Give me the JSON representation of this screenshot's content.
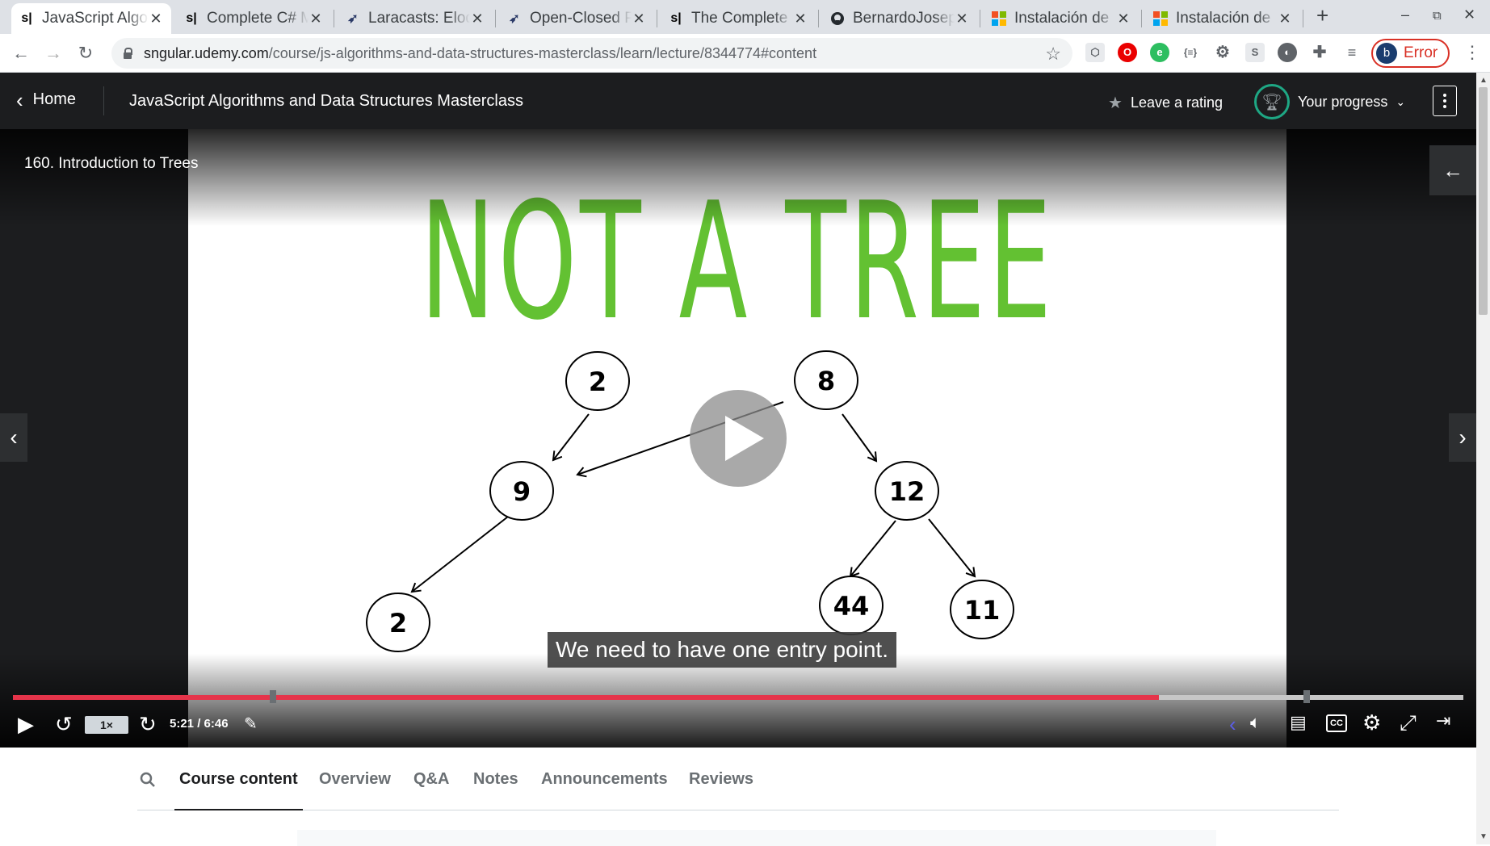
{
  "browser": {
    "tabs": [
      {
        "favicon": "udemy-icon",
        "title": "JavaScript Algorithms and Data Structures",
        "active": true
      },
      {
        "favicon": "udemy-icon",
        "title": "Complete C# Masterclass"
      },
      {
        "favicon": "laracasts-icon",
        "title": "Laracasts: Eloquent"
      },
      {
        "favicon": "laracasts-icon",
        "title": "Open-Closed Principle"
      },
      {
        "favicon": "udemy-icon",
        "title": "The Complete Guide"
      },
      {
        "favicon": "github-icon",
        "title": "BernardoJoseph"
      },
      {
        "favicon": "microsoft-icon",
        "title": "Instalación de"
      },
      {
        "favicon": "microsoft-icon",
        "title": "Instalación de"
      }
    ],
    "url_host": "sngular.udemy.com",
    "url_path": "/course/js-algorithms-and-data-structures-masterclass/learn/lecture/8344774#content",
    "profile_initial": "b",
    "profile_status": "Error"
  },
  "header": {
    "home_label": "Home",
    "course_title": "JavaScript Algorithms and Data Structures Masterclass",
    "rating_label": "Leave a rating",
    "progress_label": "Your progress"
  },
  "video": {
    "lecture_title": "160. Introduction to Trees",
    "slide_heading": "NOT A TREE",
    "nodes": [
      "2",
      "8",
      "9",
      "12",
      "2",
      "44",
      "11"
    ],
    "caption": "We need to have one entry point.",
    "playback_rate": "1×",
    "time": "5:21 / 6:46",
    "progress_fraction": 0.79,
    "cc_label": "CC"
  },
  "colors": {
    "accent_progress": "#e5344a",
    "slide_heading": "#63c132",
    "header_bg": "#1c1d1f",
    "progress_ring": "#1ea784"
  },
  "lower_tabs": [
    "Course content",
    "Overview",
    "Q&A",
    "Notes",
    "Announcements",
    "Reviews"
  ]
}
